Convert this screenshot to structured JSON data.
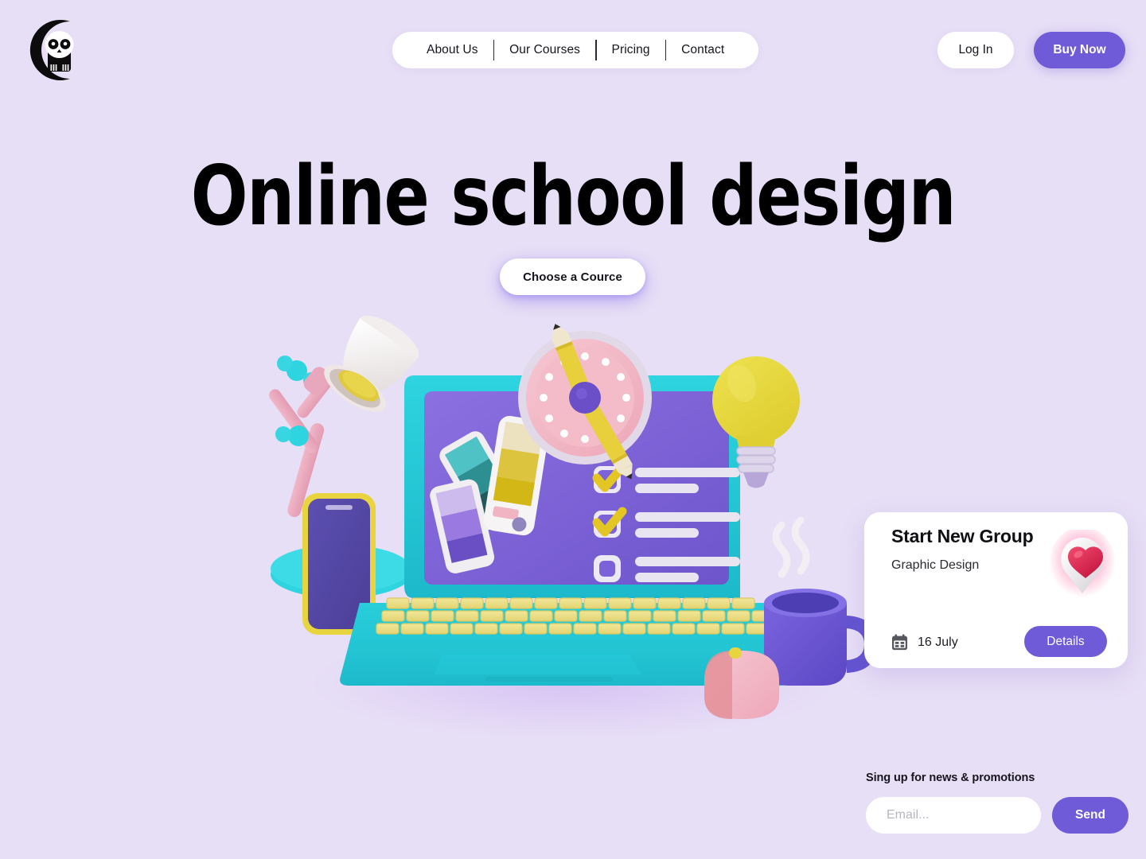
{
  "theme": {
    "background": "#e7dff6",
    "accent_purple": "#6f5bd7",
    "text_dark": "#16141c",
    "card_white": "#ffffff",
    "laptop_teal": "#22c7d6",
    "screen_purple": "#7b62d8",
    "key_yellow": "#ecdf86",
    "clock_pink": "#f2b9c4",
    "bulb_yellow": "#e3d43c",
    "mug_purple": "#6f5bd7",
    "mouse_pink": "#f3bcc3",
    "heart_red": "#d81e45"
  },
  "header": {
    "logo_name": "owl-moon-logo",
    "nav": [
      {
        "label": "About Us"
      },
      {
        "label": "Our Courses"
      },
      {
        "label": "Pricing"
      },
      {
        "label": "Contact"
      }
    ],
    "login_label": "Log In",
    "buy_label": "Buy Now"
  },
  "hero": {
    "title": "Online school design",
    "cta_label": "Choose a Cource"
  },
  "illustration": {
    "name": "3d-desk-scene",
    "objects": [
      "desk-lamp",
      "smartphone",
      "laptop",
      "color-swatch-fan",
      "checklist",
      "pencil-clock",
      "lightbulb",
      "coffee-mug",
      "computer-mouse"
    ],
    "checklist_items": [
      {
        "checked": true
      },
      {
        "checked": true
      },
      {
        "checked": false
      }
    ]
  },
  "event_card": {
    "title": "Start New Group",
    "subtitle": "Graphic Design",
    "date": "16 July",
    "details_label": "Details",
    "pin_icon": "heart-map-pin",
    "calendar_icon": "calendar-icon"
  },
  "newsletter": {
    "label": "Sing up for news & promotions",
    "placeholder": "Email...",
    "value": "",
    "send_label": "Send"
  }
}
